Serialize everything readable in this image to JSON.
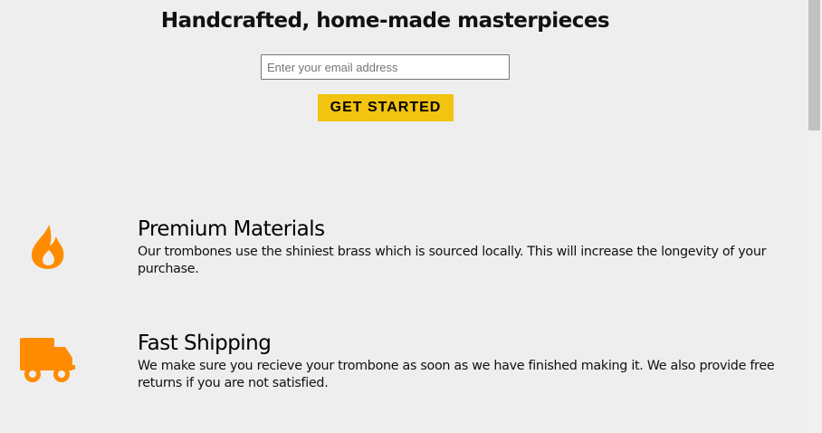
{
  "hero": {
    "title": "Handcrafted, home-made masterpieces",
    "email_placeholder": "Enter your email address",
    "cta_label": "GET STARTED"
  },
  "features": [
    {
      "icon": "fire-icon",
      "title": "Premium Materials",
      "description": "Our trombones use the shiniest brass which is sourced locally. This will increase the longevity of your purchase."
    },
    {
      "icon": "truck-icon",
      "title": "Fast Shipping",
      "description": "We make sure you recieve your trombone as soon as we have finished making it. We also provide free returns if you are not satisfied."
    }
  ],
  "colors": {
    "accent": "#f2c30f",
    "icon": "#ff8c00",
    "background": "#eeeeee"
  }
}
